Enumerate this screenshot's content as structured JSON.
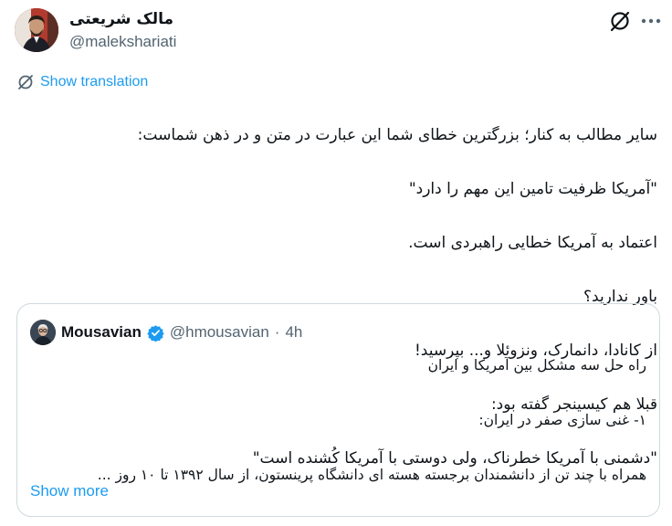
{
  "author": {
    "display_name": "مالک شریعتی",
    "handle": "@malekshariati"
  },
  "actions": {
    "grok_icon": "grok-icon",
    "more_icon": "more-icon"
  },
  "translation": {
    "label": "Show translation"
  },
  "tweet": {
    "lines": [
      "سایر مطالب به کنار؛ بزرگترین خطای شما این عبارت در متن و در ذهن شماست:",
      "\"آمریکا ظرفیت تامین این مهم را دارد\"",
      "اعتماد به آمریکا خطایی راهبردی است.",
      "باور ندارید؟",
      "از کانادا، دانمارک، ونزوئلا و... بپرسید!",
      "قبلا هم کیسینجر گفته بود:",
      "\"دشمنی با آمریکا خطرناک، ولی دوستی با آمریکا کُشنده است\""
    ]
  },
  "quote": {
    "display_name": "Mousavian",
    "handle": "@hmousavian",
    "separator": "·",
    "time": "4h",
    "verified_icon": "verified-badge-icon",
    "lines": [
      "راه حل سه مشکل بین آمریکا و ایران",
      "",
      "۱- غنی سازی صفر در ایران:",
      "",
      "همراه با چند تن از دانشمندان برجسته هسته ای دانشگاه پرینستون، از سال ۱۳۹۲ تا ۱۰ روز ..."
    ],
    "show_more": "Show more"
  },
  "colors": {
    "link": "#1d9bf0",
    "secondary": "#536471",
    "border": "#cfd9de",
    "verified": "#1d9bf0"
  }
}
